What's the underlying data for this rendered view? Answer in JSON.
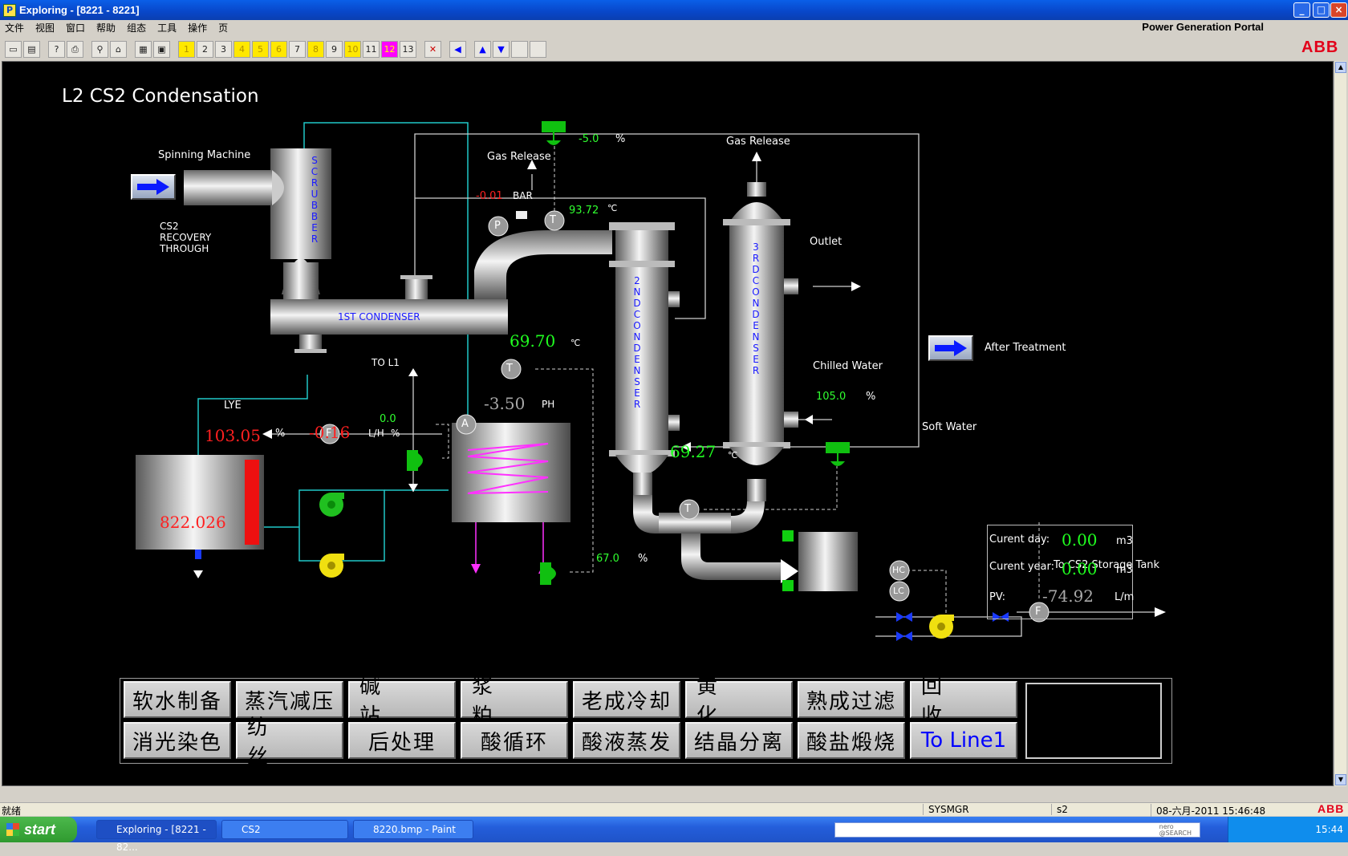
{
  "window": {
    "title": "Exploring - [8221 - 8221]",
    "app_icon": "P",
    "controls": {
      "minimize": "_",
      "maximize": "□",
      "close": "×"
    }
  },
  "menu": [
    "文件",
    "视图",
    "窗口",
    "帮助",
    "组态",
    "工具",
    "操作",
    "页"
  ],
  "portal_name": "Power Generation Portal",
  "brand": "ABB",
  "toolbar": {
    "page_numbers": [
      "1",
      "2",
      "3",
      "4",
      "5",
      "6",
      "7",
      "8",
      "9",
      "10",
      "11",
      "12",
      "13"
    ],
    "icons": [
      "new-icon",
      "open-icon",
      "help-icon",
      "print-icon",
      "search-icon",
      "home-icon",
      "trend-icon",
      "display-icon"
    ]
  },
  "process": {
    "title": "L2 CS2 Condensation",
    "labels": {
      "spinning_machine": "Spinning Machine",
      "scrubber": "SCRUBBER",
      "cs2_recovery": "CS2\nRECOVERY\nTHROUGH",
      "first_condenser": "1ST CONDENSER",
      "second_condenser": "2ND CONDENSER",
      "third_condenser": "3RD CONDENSER",
      "gas_release_1": "Gas Release",
      "gas_release_2": "Gas Release",
      "outlet": "Outlet",
      "chilled_water": "Chilled Water",
      "soft_water": "Soft Water",
      "after_treatment": "After Treatment",
      "to_l1": "TO L1",
      "lye": "LYE",
      "to_storage": "To CS2 Storage Tank",
      "bar_unit": "BAR",
      "ph_unit": "PH",
      "lh_unit": "L/H",
      "pct": "%",
      "deg": "℃"
    },
    "values": {
      "valve_top_pct": "-5.0",
      "pressure_bar": "-0.01",
      "temp_pipe": "93.72",
      "temp_first": "69.70",
      "ph": "-3.50",
      "tank_level_pct": "103.05",
      "lye_flow": "-0.16",
      "lye_valve_pct": "0.0",
      "temp_second": "69.27",
      "chilled_water_pct": "105.0",
      "heater_valve_pct": "67.0",
      "tank_value": "822.026"
    },
    "instruments": {
      "F": "F",
      "T": "T",
      "P": "P",
      "A": "A",
      "HC": "HC",
      "LC": "LC"
    },
    "counter": {
      "current_day_label": "Curent day:",
      "current_day_value": "0.00",
      "current_day_unit": "m3",
      "current_year_label": "Curent year:",
      "current_year_value": "0.00",
      "current_year_unit": "m3",
      "pv_label": "PV:",
      "pv_value": "-74.92",
      "pv_unit": "L/m"
    }
  },
  "nav_buttons": [
    [
      "软水制备",
      "蒸汽减压",
      "碱站",
      "浆粕",
      "老成冷却",
      "黄化",
      "熟成过滤",
      "回收"
    ],
    [
      "消光染色",
      "纺丝",
      "后处理",
      "酸循环",
      "酸液蒸发",
      "结晶分离",
      "酸盐煅烧",
      "To Line1"
    ]
  ],
  "status": {
    "ready": "就绪",
    "user": "SYSMGR",
    "node": "s2",
    "datetime": "08-六月-2011 15:46:48"
  },
  "taskbar": {
    "start": "start",
    "tasks": [
      "Exploring - [8221 - 82...",
      "CS2",
      "8220.bmp - Paint"
    ],
    "search_brand": "nero\n@SEARCH",
    "clock": "15:44"
  },
  "colors": {
    "alarm_red": "#ff2020",
    "value_green": "#20ff20",
    "valve_green": "#10c010",
    "pipe_cyan": "#20c8c8",
    "condenser_text_blue": "#1a1aff",
    "heater_coil": "#ff30ff"
  }
}
